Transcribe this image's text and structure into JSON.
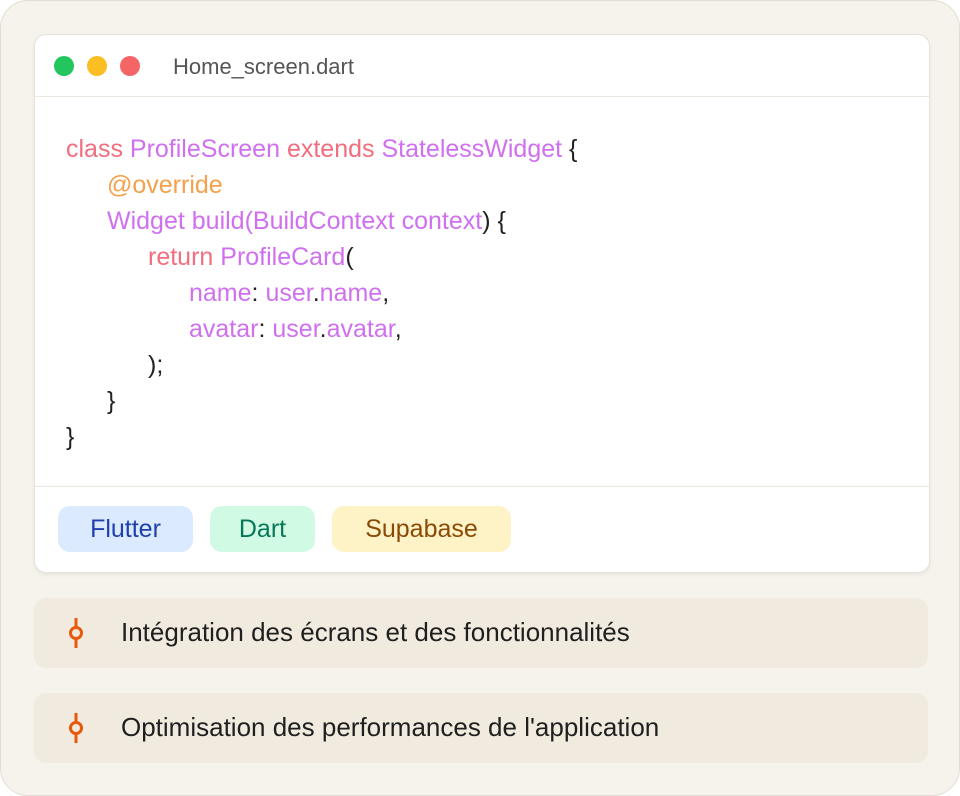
{
  "editor": {
    "filename": "Home_screen.dart",
    "window_controls": [
      "green-dot",
      "yellow-dot",
      "red-dot"
    ],
    "code_lines": [
      {
        "indent": 0,
        "tokens": [
          {
            "t": "class ",
            "c": "kw"
          },
          {
            "t": "ProfileScreen ",
            "c": "ty"
          },
          {
            "t": "extends ",
            "c": "kw"
          },
          {
            "t": "StatelessWidget",
            "c": "ty"
          },
          {
            "t": " {",
            "c": "pn"
          }
        ]
      },
      {
        "indent": 1,
        "tokens": [
          {
            "t": "@override",
            "c": "an"
          }
        ]
      },
      {
        "indent": 1,
        "tokens": [
          {
            "t": "Widget ",
            "c": "ty"
          },
          {
            "t": "build",
            "c": "ty"
          },
          {
            "t": "(",
            "c": "ty"
          },
          {
            "t": "BuildContext ",
            "c": "ty"
          },
          {
            "t": "context",
            "c": "ty"
          },
          {
            "t": ") {",
            "c": "pn"
          }
        ]
      },
      {
        "indent": 2,
        "tokens": [
          {
            "t": "return ",
            "c": "kw"
          },
          {
            "t": "ProfileCard",
            "c": "ty"
          },
          {
            "t": "(",
            "c": "pn"
          }
        ]
      },
      {
        "indent": 3,
        "tokens": [
          {
            "t": "name",
            "c": "ty"
          },
          {
            "t": ": ",
            "c": "pn"
          },
          {
            "t": "user",
            "c": "ty"
          },
          {
            "t": ".",
            "c": "pn"
          },
          {
            "t": "name",
            "c": "ty"
          },
          {
            "t": ",",
            "c": "pn"
          }
        ]
      },
      {
        "indent": 3,
        "tokens": [
          {
            "t": "avatar",
            "c": "ty"
          },
          {
            "t": ": ",
            "c": "pn"
          },
          {
            "t": "user",
            "c": "ty"
          },
          {
            "t": ".",
            "c": "pn"
          },
          {
            "t": "avatar",
            "c": "ty"
          },
          {
            "t": ",",
            "c": "pn"
          }
        ]
      },
      {
        "indent": 2,
        "tokens": [
          {
            "t": ");",
            "c": "pn"
          }
        ]
      },
      {
        "indent": 1,
        "tokens": [
          {
            "t": "}",
            "c": "pn"
          }
        ]
      },
      {
        "indent": 0,
        "tokens": [
          {
            "t": "}",
            "c": "pn"
          }
        ]
      }
    ],
    "syntax_colors": {
      "keyword": "#f26d7d",
      "type": "#d070f0",
      "annotation": "#f5a04a",
      "punctuation": "#222222"
    }
  },
  "tags": [
    {
      "label": "Flutter",
      "bg": "#dbeafe",
      "fg": "#1e40af"
    },
    {
      "label": "Dart",
      "bg": "#d1fae5",
      "fg": "#047857"
    },
    {
      "label": "Supabase",
      "bg": "#fef3c7",
      "fg": "#8a4a06"
    }
  ],
  "items": [
    {
      "label": "Intégration des écrans et des fonctionnalités",
      "icon": "commit-icon"
    },
    {
      "label": "Optimisation des performances de l'application",
      "icon": "commit-icon"
    }
  ],
  "accent": "#e8590c"
}
